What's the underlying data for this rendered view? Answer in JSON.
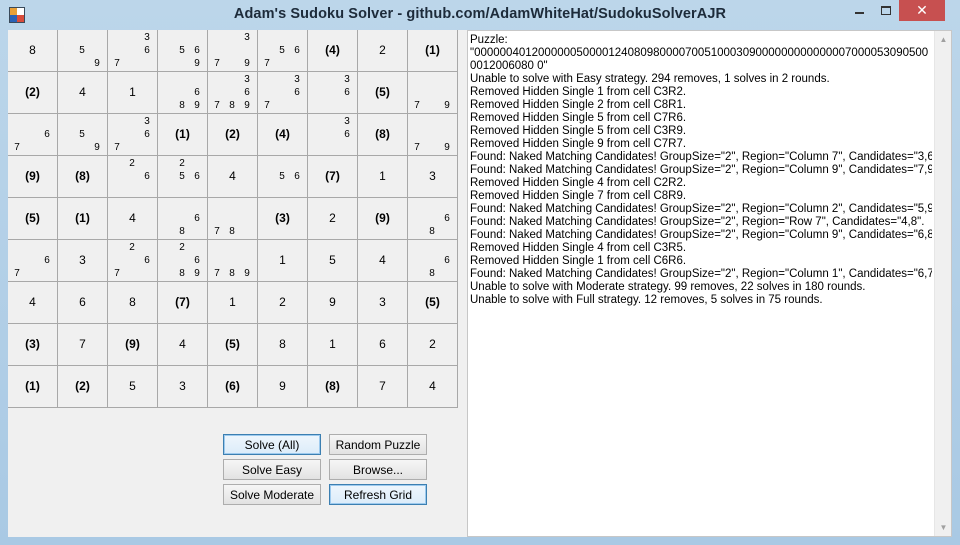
{
  "window": {
    "title": "Adam's Sudoku Solver - github.com/AdamWhiteHat/SudokuSolverAJR",
    "minimize_icon": "minimize-icon",
    "maximize_icon": "maximize-icon",
    "close_icon": "close-icon",
    "close_glyph": "✕"
  },
  "grid": {
    "rows": [
      [
        {
          "v": "8"
        },
        {
          "c": {
            "5": "5",
            "9": "9"
          }
        },
        {
          "c": {
            "3": "3",
            "6": "6",
            "7": "7"
          }
        },
        {
          "c": {
            "5": "5",
            "6": "6",
            "9": "9"
          }
        },
        {
          "c": {
            "3": "3",
            "7": "7",
            "9": "9"
          }
        },
        {
          "c": {
            "5": "5",
            "6": "6",
            "7": "7"
          }
        },
        {
          "v": "(4)",
          "f": true
        },
        {
          "v": "2"
        },
        {
          "v": "(1)",
          "f": true
        }
      ],
      [
        {
          "v": "(2)",
          "f": true
        },
        {
          "v": "4"
        },
        {
          "v": "1"
        },
        {
          "c": {
            "6": "6",
            "8": "8",
            "9": "9"
          }
        },
        {
          "c": {
            "3": "3",
            "6": "6",
            "7": "7",
            "8": "8",
            "9": "9"
          }
        },
        {
          "c": {
            "3": "3",
            "6": "6",
            "7": "7"
          }
        },
        {
          "c": {
            "3": "3",
            "6": "6"
          }
        },
        {
          "v": "(5)",
          "f": true
        },
        {
          "c": {
            "7": "7",
            "9": "9"
          }
        }
      ],
      [
        {
          "c": {
            "6": "6",
            "7": "7"
          }
        },
        {
          "c": {
            "5": "5",
            "9": "9"
          }
        },
        {
          "c": {
            "3": "3",
            "6": "6",
            "7": "7"
          }
        },
        {
          "v": "(1)",
          "f": true
        },
        {
          "v": "(2)",
          "f": true
        },
        {
          "v": "(4)",
          "f": true
        },
        {
          "c": {
            "3": "3",
            "6": "6"
          }
        },
        {
          "v": "(8)",
          "f": true
        },
        {
          "c": {
            "7": "7",
            "9": "9"
          }
        }
      ],
      [
        {
          "v": "(9)",
          "f": true
        },
        {
          "v": "(8)",
          "f": true
        },
        {
          "c": {
            "2": "2",
            "6": "6"
          }
        },
        {
          "c": {
            "2": "2",
            "5": "5",
            "6": "6"
          }
        },
        {
          "v": "4"
        },
        {
          "c": {
            "5": "5",
            "6": "6"
          }
        },
        {
          "v": "(7)",
          "f": true
        },
        {
          "v": "1"
        },
        {
          "v": "3"
        }
      ],
      [
        {
          "v": "(5)",
          "f": true
        },
        {
          "v": "(1)",
          "f": true
        },
        {
          "v": "4"
        },
        {
          "c": {
            "6": "6",
            "8": "8"
          }
        },
        {
          "c": {
            "7": "7",
            "8": "8"
          }
        },
        {
          "v": "(3)",
          "f": true
        },
        {
          "v": "2"
        },
        {
          "v": "(9)",
          "f": true
        },
        {
          "c": {
            "6": "6",
            "8": "8"
          }
        }
      ],
      [
        {
          "c": {
            "6": "6",
            "7": "7"
          }
        },
        {
          "v": "3"
        },
        {
          "c": {
            "2": "2",
            "6": "6",
            "7": "7"
          }
        },
        {
          "c": {
            "2": "2",
            "6": "6",
            "8": "8",
            "9": "9"
          }
        },
        {
          "c": {
            "7": "7",
            "8": "8",
            "9": "9"
          }
        },
        {
          "v": "1"
        },
        {
          "v": "5"
        },
        {
          "v": "4"
        },
        {
          "c": {
            "6": "6",
            "8": "8"
          }
        }
      ],
      [
        {
          "v": "4"
        },
        {
          "v": "6"
        },
        {
          "v": "8"
        },
        {
          "v": "(7)",
          "f": true
        },
        {
          "v": "1"
        },
        {
          "v": "2"
        },
        {
          "v": "9"
        },
        {
          "v": "3"
        },
        {
          "v": "(5)",
          "f": true
        }
      ],
      [
        {
          "v": "(3)",
          "f": true
        },
        {
          "v": "7"
        },
        {
          "v": "(9)",
          "f": true
        },
        {
          "v": "4"
        },
        {
          "v": "(5)",
          "f": true
        },
        {
          "v": "8"
        },
        {
          "v": "1"
        },
        {
          "v": "6"
        },
        {
          "v": "2"
        }
      ],
      [
        {
          "v": "(1)",
          "f": true
        },
        {
          "v": "(2)",
          "f": true
        },
        {
          "v": "5"
        },
        {
          "v": "3"
        },
        {
          "v": "(6)",
          "f": true
        },
        {
          "v": "9"
        },
        {
          "v": "(8)",
          "f": true
        },
        {
          "v": "7"
        },
        {
          "v": "4"
        }
      ]
    ]
  },
  "buttons": {
    "solve_all": "Solve (All)",
    "random_puzzle": "Random Puzzle",
    "solve_easy": "Solve Easy",
    "browse": "Browse...",
    "solve_moderate": "Solve Moderate",
    "refresh_grid": "Refresh Grid"
  },
  "log": {
    "lines": [
      "Puzzle:",
      "\"000000401200000050000124080980000700510003090000000000000070000530905000012006080 0\"",
      "Unable to solve with Easy strategy. 294 removes, 1 solves in 2 rounds.",
      "Removed Hidden Single 1 from cell C3R2.",
      "Removed Hidden Single 2 from cell C8R1.",
      "Removed Hidden Single 5 from cell C7R6.",
      "Removed Hidden Single 5 from cell C3R9.",
      "Removed Hidden Single 9 from cell C7R7.",
      "Found: Naked Matching Candidates! GroupSize=\"2\", Region=\"Column 7\", Candidates=\"3,6\".",
      "Found: Naked Matching Candidates! GroupSize=\"2\", Region=\"Column 9\", Candidates=\"7,9\".",
      "Removed Hidden Single 4 from cell C2R2.",
      "Removed Hidden Single 7 from cell C8R9.",
      "Found: Naked Matching Candidates! GroupSize=\"2\", Region=\"Column 2\", Candidates=\"5,9\".",
      "Found: Naked Matching Candidates! GroupSize=\"2\", Region=\"Row 7\", Candidates=\"4,8\".",
      "Found: Naked Matching Candidates! GroupSize=\"2\", Region=\"Column 9\", Candidates=\"6,8\".",
      "Removed Hidden Single 4 from cell C3R5.",
      "Removed Hidden Single 1 from cell C6R6.",
      "Found: Naked Matching Candidates! GroupSize=\"2\", Region=\"Column 1\", Candidates=\"6,7\".",
      "Unable to solve with Moderate strategy. 99 removes, 22 solves in 180 rounds.",
      "Unable to solve with Full strategy. 12 removes, 5 solves in 75 rounds."
    ]
  },
  "scrollbar": {
    "up_icon": "scroll-up-arrow-icon",
    "down_icon": "scroll-down-arrow-icon",
    "up_glyph": "▲",
    "down_glyph": "▼"
  }
}
